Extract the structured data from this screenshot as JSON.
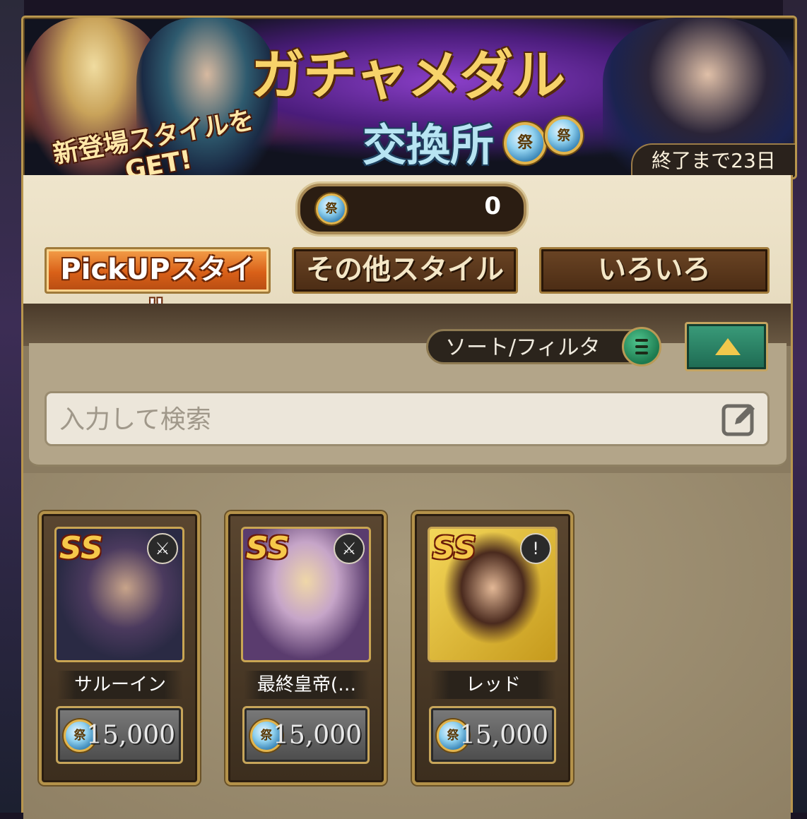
{
  "banner": {
    "title": "ガチャメダル",
    "subtitle": "交換所",
    "tagline": "新登場スタイルをGET!",
    "medal_glyph": "祭",
    "countdown": "終了まで23日"
  },
  "balance": {
    "medal_glyph": "祭",
    "value": "0"
  },
  "tabs": [
    {
      "label": "PickUPスタイル",
      "active": true
    },
    {
      "label": "その他スタイル",
      "active": false
    },
    {
      "label": "いろいろ",
      "active": false
    }
  ],
  "sort_filter": {
    "label": "ソート/フィルタ",
    "icon": "menu-icon"
  },
  "collapse_button": {
    "icon": "triangle-up-icon"
  },
  "search": {
    "placeholder": "入力して検索",
    "value": "",
    "icon": "edit-icon"
  },
  "cards": [
    {
      "rank": "SS",
      "weapon_icon": "sword-icon",
      "weapon_glyph": "⚔",
      "name": "サルーイン",
      "medal_glyph": "祭",
      "price": "15,000"
    },
    {
      "rank": "SS",
      "weapon_icon": "sword-icon",
      "weapon_glyph": "⚔",
      "name": "最終皇帝(…",
      "medal_glyph": "祭",
      "price": "15,000"
    },
    {
      "rank": "SS",
      "weapon_icon": "fist-icon",
      "weapon_glyph": "!",
      "name": "レッド",
      "medal_glyph": "祭",
      "price": "15,000"
    }
  ],
  "colors": {
    "active_tab": "#d96018",
    "panel_bg": "#efe5cc",
    "gold_border": "#b8964e",
    "green_button": "#1e6a52"
  }
}
